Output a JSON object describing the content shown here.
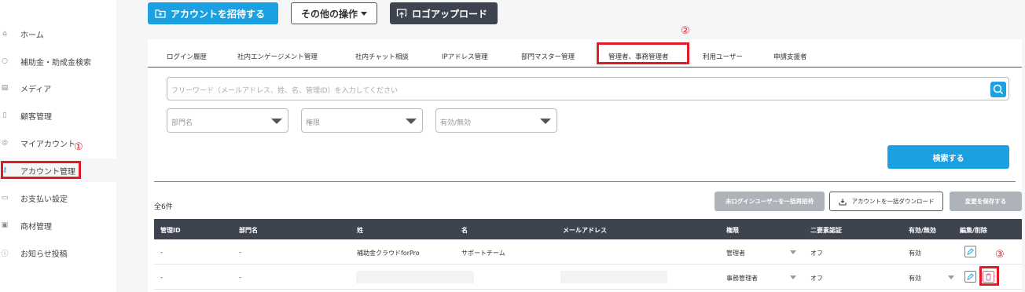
{
  "sidebar": {
    "items": [
      {
        "icon": "home-icon",
        "label": "ホーム"
      },
      {
        "icon": "search-icon",
        "label": "補助金・助成金検索"
      },
      {
        "icon": "media-icon",
        "label": "メディア"
      },
      {
        "icon": "customers-icon",
        "label": "顧客管理"
      },
      {
        "icon": "user-icon",
        "label": "マイアカウント"
      },
      {
        "icon": "key-icon",
        "label": "アカウント管理"
      },
      {
        "icon": "card-icon",
        "label": "お支払い設定"
      },
      {
        "icon": "briefcase-icon",
        "label": "商材管理"
      },
      {
        "icon": "info-icon",
        "label": "お知らせ投稿"
      }
    ]
  },
  "annotations": {
    "one": "①",
    "two": "②",
    "three": "③"
  },
  "toolbar": {
    "invite_label": "アカウントを招待する",
    "other_label": "その他の操作",
    "logo_label": "ロゴアップロード"
  },
  "tabs": [
    "ログイン履歴",
    "社内エンゲージメント管理",
    "社内チャット相談",
    "IPアドレス管理",
    "部門マスター管理",
    "管理者、事務管理者",
    "利用ユーザー",
    "申請支援者"
  ],
  "search": {
    "placeholder": "フリーワード（メールアドレス、姓、名、管理ID）を入力してください",
    "dept_placeholder": "部門名",
    "role_placeholder": "権限",
    "status_placeholder": "有効/無効",
    "search_button": "検索する"
  },
  "list": {
    "total": "全6件",
    "invite_unlogged": "未ログインユーザーを一括再招待",
    "download_all": "アカウントを一括ダウンロード",
    "save_changes": "変更を保存する"
  },
  "table": {
    "headers": [
      "管理ID",
      "部門名",
      "姓",
      "名",
      "メールアドレス",
      "権限",
      "二要素認証",
      "有効/無効",
      "編集/削除"
    ],
    "rows": [
      {
        "id": "-",
        "dept": "-",
        "last": "補助金クラウドforPro",
        "first": "サポートチーム",
        "email": "",
        "role": "管理者",
        "mfa": "オフ",
        "status": "有効"
      },
      {
        "id": "-",
        "dept": "-",
        "last": "",
        "first": "",
        "email": "",
        "role": "事務管理者",
        "mfa": "オフ",
        "status": "有効"
      }
    ]
  },
  "colors": {
    "accent": "#1ba1e2",
    "dark": "#3d4450",
    "highlight": "#e01b24"
  }
}
